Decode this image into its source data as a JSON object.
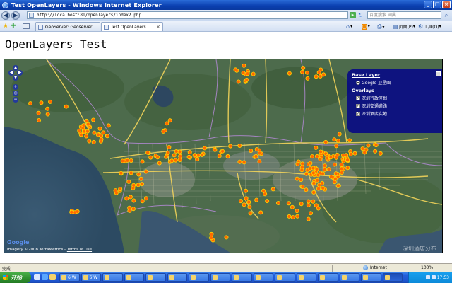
{
  "window": {
    "title": "Test OpenLayers - Windows Internet Explorer",
    "buttons": [
      "_",
      "□",
      "×"
    ]
  },
  "address_bar": {
    "back_icon": "back-arrow-icon",
    "forward_icon": "forward-arrow-icon",
    "url": "http://localhost:81/openlayers/index2.php",
    "search_placeholder": "百度搜索 词典"
  },
  "tabs": [
    {
      "label": "GeoServer: Geoserver",
      "active": false
    },
    {
      "label": "Test OpenLayers",
      "active": true
    }
  ],
  "command_bar": {
    "page_label": "页面(P)",
    "tools_label": "工具(O)"
  },
  "page": {
    "heading": "OpenLayers Test"
  },
  "map": {
    "layer_switcher": {
      "base_layer_heading": "Base Layer",
      "base_layer": "Google 卫星图",
      "overlays_heading": "Overlays",
      "overlays": [
        "深圳行政区划",
        "深圳交通道路",
        "深圳酒店实地"
      ]
    },
    "logo_text": "Google",
    "attribution": "Imagery ©2008 TerraMetrics - ",
    "terms_link": "Terms of Use",
    "watermark": "深圳酒店分布"
  },
  "status_bar": {
    "status": "完成",
    "zone": "Internet",
    "zoom": "100%"
  },
  "taskbar": {
    "start_label": "开始",
    "clock": "17:53",
    "buttons": [
      "6 W",
      "6 W",
      "",
      "",
      "",
      "",
      "",
      "",
      "",
      "",
      "",
      "",
      "",
      "",
      "",
      ""
    ]
  },
  "colors": {
    "layer_switcher_bg": "#00008b",
    "marker": "#ff6a00",
    "roads": "#f2d45a",
    "xp_blue": "#245edb"
  }
}
